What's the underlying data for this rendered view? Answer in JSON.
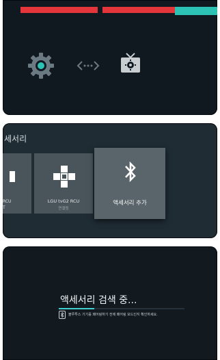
{
  "panel1": {
    "accent_colors": {
      "red": "#e4353a",
      "teal": "#2cc3b4"
    },
    "icons": [
      "gear-icon",
      "connection-arrows-icon",
      "tv-settings-icon"
    ]
  },
  "panel2": {
    "title": "세서리",
    "devices": [
      {
        "name": "RCU",
        "status": "T"
      },
      {
        "name": "LGU tvG2 RCU",
        "status": "연결됨"
      }
    ],
    "add_card": {
      "label": "액세서리 추가",
      "icon": "bluetooth-icon"
    }
  },
  "panel3": {
    "title": "액세서리 검색 중...",
    "progress": 0.28,
    "hint": "블루투스 기기를 페어링하기 전에 페어링 모드인지 확인하세요.",
    "hint_icon": "bluetooth-icon"
  },
  "colors": {
    "progress": "#3fd1d0",
    "panel_bg": "#101820"
  }
}
